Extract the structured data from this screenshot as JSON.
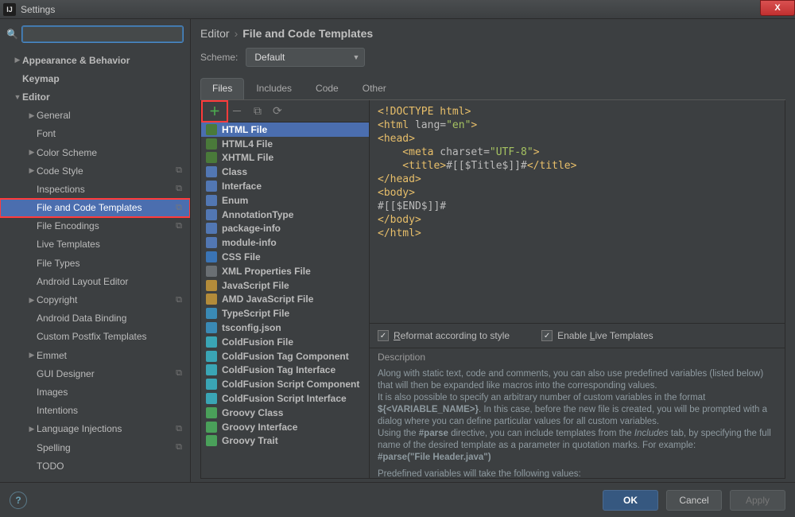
{
  "window": {
    "title": "Settings",
    "close": "X"
  },
  "breadcrumb": {
    "a": "Editor",
    "b": "File and Code Templates"
  },
  "scheme": {
    "label": "Scheme:",
    "value": "Default"
  },
  "tabs": {
    "files": "Files",
    "includes": "Includes",
    "code": "Code",
    "other": "Other"
  },
  "sidebar": [
    {
      "label": "Appearance & Behavior",
      "arrow": "▶",
      "bold": true,
      "depth": 0
    },
    {
      "label": "Keymap",
      "arrow": "",
      "bold": true,
      "depth": 0
    },
    {
      "label": "Editor",
      "arrow": "▼",
      "bold": true,
      "depth": 0
    },
    {
      "label": "General",
      "arrow": "▶",
      "bold": false,
      "depth": 1
    },
    {
      "label": "Font",
      "arrow": "",
      "bold": false,
      "depth": 1
    },
    {
      "label": "Color Scheme",
      "arrow": "▶",
      "bold": false,
      "depth": 1
    },
    {
      "label": "Code Style",
      "arrow": "▶",
      "bold": false,
      "depth": 1,
      "badge": true
    },
    {
      "label": "Inspections",
      "arrow": "",
      "bold": false,
      "depth": 1,
      "badge": true
    },
    {
      "label": "File and Code Templates",
      "arrow": "",
      "bold": false,
      "depth": 1,
      "badge": true,
      "selected": true,
      "hl": true
    },
    {
      "label": "File Encodings",
      "arrow": "",
      "bold": false,
      "depth": 1,
      "badge": true
    },
    {
      "label": "Live Templates",
      "arrow": "",
      "bold": false,
      "depth": 1
    },
    {
      "label": "File Types",
      "arrow": "",
      "bold": false,
      "depth": 1
    },
    {
      "label": "Android Layout Editor",
      "arrow": "",
      "bold": false,
      "depth": 1
    },
    {
      "label": "Copyright",
      "arrow": "▶",
      "bold": false,
      "depth": 1,
      "badge": true
    },
    {
      "label": "Android Data Binding",
      "arrow": "",
      "bold": false,
      "depth": 1
    },
    {
      "label": "Custom Postfix Templates",
      "arrow": "",
      "bold": false,
      "depth": 1
    },
    {
      "label": "Emmet",
      "arrow": "▶",
      "bold": false,
      "depth": 1
    },
    {
      "label": "GUI Designer",
      "arrow": "",
      "bold": false,
      "depth": 1,
      "badge": true
    },
    {
      "label": "Images",
      "arrow": "",
      "bold": false,
      "depth": 1
    },
    {
      "label": "Intentions",
      "arrow": "",
      "bold": false,
      "depth": 1
    },
    {
      "label": "Language Injections",
      "arrow": "▶",
      "bold": false,
      "depth": 1,
      "badge": true
    },
    {
      "label": "Spelling",
      "arrow": "",
      "bold": false,
      "depth": 1,
      "badge": true
    },
    {
      "label": "TODO",
      "arrow": "",
      "bold": false,
      "depth": 1
    }
  ],
  "templates": [
    {
      "label": "HTML File",
      "cls": "fc-html",
      "selected": true
    },
    {
      "label": "HTML4 File",
      "cls": "fc-html"
    },
    {
      "label": "XHTML File",
      "cls": "fc-html"
    },
    {
      "label": "Class",
      "cls": "fc-class"
    },
    {
      "label": "Interface",
      "cls": "fc-class"
    },
    {
      "label": "Enum",
      "cls": "fc-class"
    },
    {
      "label": "AnnotationType",
      "cls": "fc-class"
    },
    {
      "label": "package-info",
      "cls": "fc-class"
    },
    {
      "label": "module-info",
      "cls": "fc-class"
    },
    {
      "label": "CSS File",
      "cls": "fc-css"
    },
    {
      "label": "XML Properties File",
      "cls": "fc-generic"
    },
    {
      "label": "JavaScript File",
      "cls": "fc-js"
    },
    {
      "label": "AMD JavaScript File",
      "cls": "fc-js"
    },
    {
      "label": "TypeScript File",
      "cls": "fc-ts"
    },
    {
      "label": "tsconfig.json",
      "cls": "fc-ts"
    },
    {
      "label": "ColdFusion File",
      "cls": "fc-cf"
    },
    {
      "label": "ColdFusion Tag Component",
      "cls": "fc-cf"
    },
    {
      "label": "ColdFusion Tag Interface",
      "cls": "fc-cf"
    },
    {
      "label": "ColdFusion Script Component",
      "cls": "fc-cf"
    },
    {
      "label": "ColdFusion Script Interface",
      "cls": "fc-cf"
    },
    {
      "label": "Groovy Class",
      "cls": "fc-groovy"
    },
    {
      "label": "Groovy Interface",
      "cls": "fc-groovy"
    },
    {
      "label": "Groovy Trait",
      "cls": "fc-groovy"
    }
  ],
  "code_lines": [
    [
      {
        "t": "<!DOCTYPE html>",
        "c": "c-tag"
      }
    ],
    [
      {
        "t": "<html ",
        "c": "c-tag"
      },
      {
        "t": "lang=",
        "c": "c-attr"
      },
      {
        "t": "\"en\"",
        "c": "c-str"
      },
      {
        "t": ">",
        "c": "c-tag"
      }
    ],
    [
      {
        "t": "<head>",
        "c": "c-tag"
      }
    ],
    [
      {
        "t": "    <meta ",
        "c": "c-tag"
      },
      {
        "t": "charset=",
        "c": "c-attr"
      },
      {
        "t": "\"UTF-8\"",
        "c": "c-str"
      },
      {
        "t": ">",
        "c": "c-tag"
      }
    ],
    [
      {
        "t": "    <title>",
        "c": "c-tag"
      },
      {
        "t": "#[[$Title$]]#",
        "c": "c-attr"
      },
      {
        "t": "</title>",
        "c": "c-tag"
      }
    ],
    [
      {
        "t": "</head>",
        "c": "c-tag"
      }
    ],
    [
      {
        "t": "<body>",
        "c": "c-tag"
      }
    ],
    [
      {
        "t": "#[[$END$]]#",
        "c": "c-attr"
      }
    ],
    [
      {
        "t": "</body>",
        "c": "c-tag"
      }
    ],
    [
      {
        "t": "</html>",
        "c": "c-tag"
      }
    ]
  ],
  "options": {
    "reformat_pre": "R",
    "reformat": "eformat according to style",
    "live_pre": "Enable ",
    "live_u": "L",
    "live_post": "ive Templates"
  },
  "description": {
    "title": "Description",
    "p1a": "Along with static text, code and comments, you can also use predefined variables (listed below) that will then be expanded like macros into the corresponding values.",
    "p2a": "It is also possible to specify an arbitrary number of custom variables in the format ",
    "p2b": "${<VARIABLE_NAME>}",
    "p2c": ". In this case, before the new file is created, you will be prompted with a dialog where you can define particular values for all custom variables.",
    "p3a": "Using the ",
    "p3b": "#parse",
    "p3c": " directive, you can include templates from the ",
    "p3d": "Includes",
    "p3e": " tab, by specifying the full name of the desired template as a parameter in quotation marks. For example:",
    "p4": "#parse(\"File Header.java\")",
    "p5": "Predefined variables will take the following values:"
  },
  "footer": {
    "ok": "OK",
    "cancel": "Cancel",
    "apply": "Apply"
  }
}
